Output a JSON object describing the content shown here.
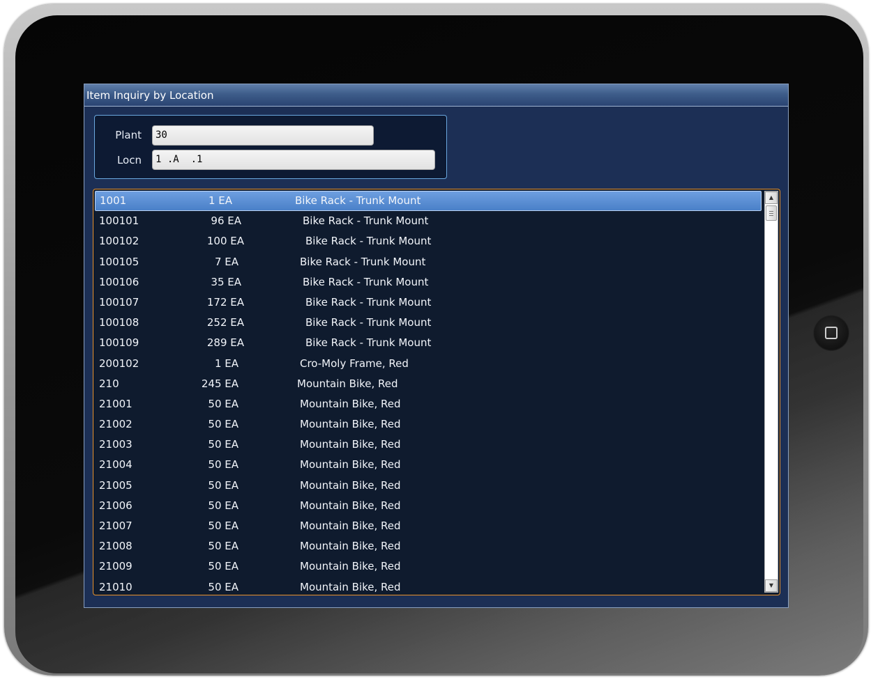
{
  "window": {
    "title": "Item Inquiry by Location"
  },
  "filters": {
    "plant_label": "Plant",
    "plant_value": "30",
    "locn_label": "Locn",
    "locn_value": "1 .A  .1"
  },
  "list": {
    "selected_index": 0,
    "rows": [
      {
        "item": "1001",
        "qty": "1 EA",
        "desc": "Bike Rack - Trunk Mount"
      },
      {
        "item": "100101",
        "qty": "96 EA",
        "desc": "Bike Rack - Trunk Mount"
      },
      {
        "item": "100102",
        "qty": "100 EA",
        "desc": "Bike Rack - Trunk Mount"
      },
      {
        "item": "100105",
        "qty": "7 EA",
        "desc": "Bike Rack - Trunk Mount"
      },
      {
        "item": "100106",
        "qty": "35 EA",
        "desc": "Bike Rack - Trunk Mount"
      },
      {
        "item": "100107",
        "qty": "172 EA",
        "desc": "Bike Rack - Trunk Mount"
      },
      {
        "item": "100108",
        "qty": "252 EA",
        "desc": "Bike Rack - Trunk Mount"
      },
      {
        "item": "100109",
        "qty": "289 EA",
        "desc": "Bike Rack - Trunk Mount"
      },
      {
        "item": "200102",
        "qty": "1 EA",
        "desc": "Cro-Moly Frame, Red"
      },
      {
        "item": "210",
        "qty": "245 EA",
        "desc": "Mountain Bike, Red"
      },
      {
        "item": "21001",
        "qty": "50 EA",
        "desc": "Mountain Bike, Red"
      },
      {
        "item": "21002",
        "qty": "50 EA",
        "desc": "Mountain Bike, Red"
      },
      {
        "item": "21003",
        "qty": "50 EA",
        "desc": "Mountain Bike, Red"
      },
      {
        "item": "21004",
        "qty": "50 EA",
        "desc": "Mountain Bike, Red"
      },
      {
        "item": "21005",
        "qty": "50 EA",
        "desc": "Mountain Bike, Red"
      },
      {
        "item": "21006",
        "qty": "50 EA",
        "desc": "Mountain Bike, Red"
      },
      {
        "item": "21007",
        "qty": "50 EA",
        "desc": "Mountain Bike, Red"
      },
      {
        "item": "21008",
        "qty": "50 EA",
        "desc": "Mountain Bike, Red"
      },
      {
        "item": "21009",
        "qty": "50 EA",
        "desc": "Mountain Bike, Red"
      },
      {
        "item": "21010",
        "qty": "50 EA",
        "desc": "Mountain Bike, Red"
      }
    ]
  },
  "icons": {
    "scroll_up": "scroll-up-arrow-icon",
    "scroll_down": "scroll-down-arrow-icon",
    "home": "home-button-square-icon"
  },
  "colors": {
    "selection": "#4a80c8",
    "list_border": "#e8922b",
    "filter_border": "#6aa8e0"
  }
}
